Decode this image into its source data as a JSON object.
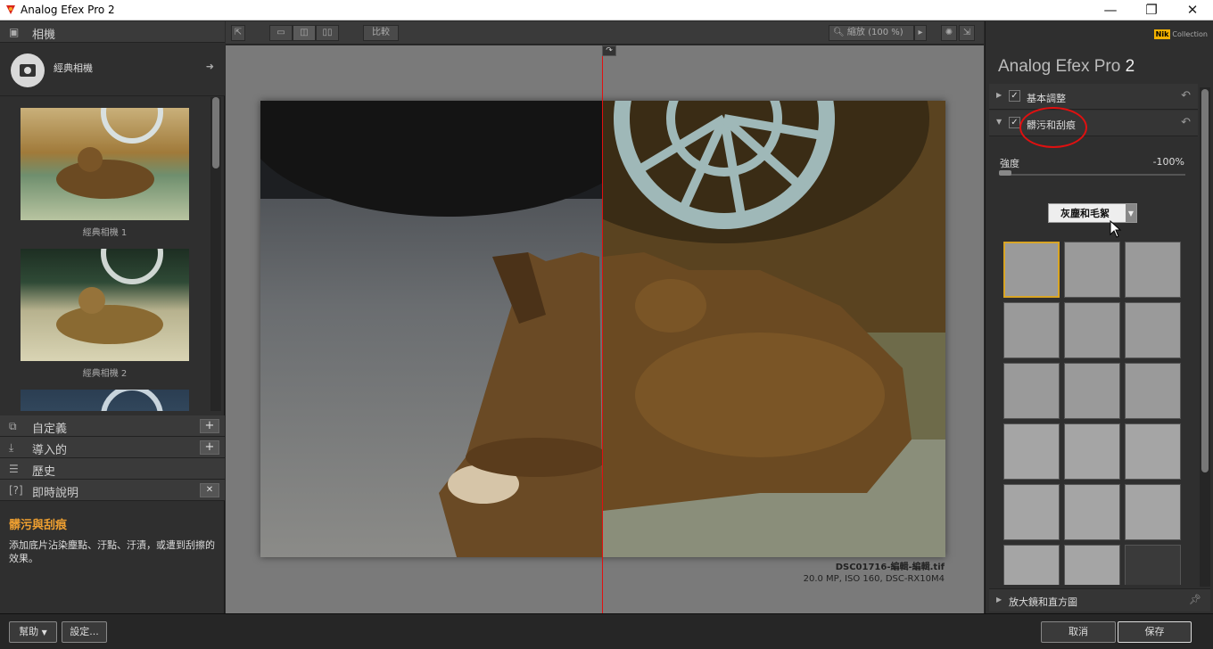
{
  "window": {
    "title": "Analog Efex Pro 2",
    "minimize": "—",
    "maximize": "❐",
    "close": "✕"
  },
  "left_panel": {
    "camera_section": "相機",
    "preset_name": "經典相機",
    "thumbnails": [
      {
        "label": "經典相機 1"
      },
      {
        "label": "經典相機 2"
      },
      {
        "label": ""
      }
    ],
    "sections": [
      {
        "label": "自定義",
        "action": "+"
      },
      {
        "label": "導入的",
        "action": "+"
      },
      {
        "label": "歷史",
        "action": ""
      },
      {
        "label": "即時說明",
        "action": "✕"
      }
    ],
    "help_title": "髒污與刮痕",
    "help_text": "添加底片沾染塵點、汙點、汙漬，或遭到刮擦的效果。"
  },
  "toolbar": {
    "compare_label": "比較",
    "zoom_label": "縮放 (100 %)"
  },
  "canvas": {
    "filename": "DSC01716-編輯-編輯.tif",
    "fileinfo": "20.0 MP, ISO 160, DSC-RX10M4"
  },
  "right_panel": {
    "brand": "Nik",
    "brand_sub": "Collection",
    "product_name": "Analog Efex Pro",
    "product_version": "2",
    "sections": [
      {
        "label": "基本調整",
        "checked": true,
        "expanded": false
      },
      {
        "label": "髒污和刮痕",
        "checked": true,
        "expanded": true
      }
    ],
    "strength_label": "強度",
    "strength_value": "-100%",
    "dropdown_value": "灰塵和毛絮",
    "bottom_section": "放大鏡和直方圖"
  },
  "bottom_bar": {
    "help_button": "幫助",
    "settings_button": "設定...",
    "cancel_button": "取消",
    "save_button": "保存"
  },
  "colors": {
    "accent": "#f0a030",
    "split_line": "#e21010",
    "selected_border": "#d9a525"
  }
}
